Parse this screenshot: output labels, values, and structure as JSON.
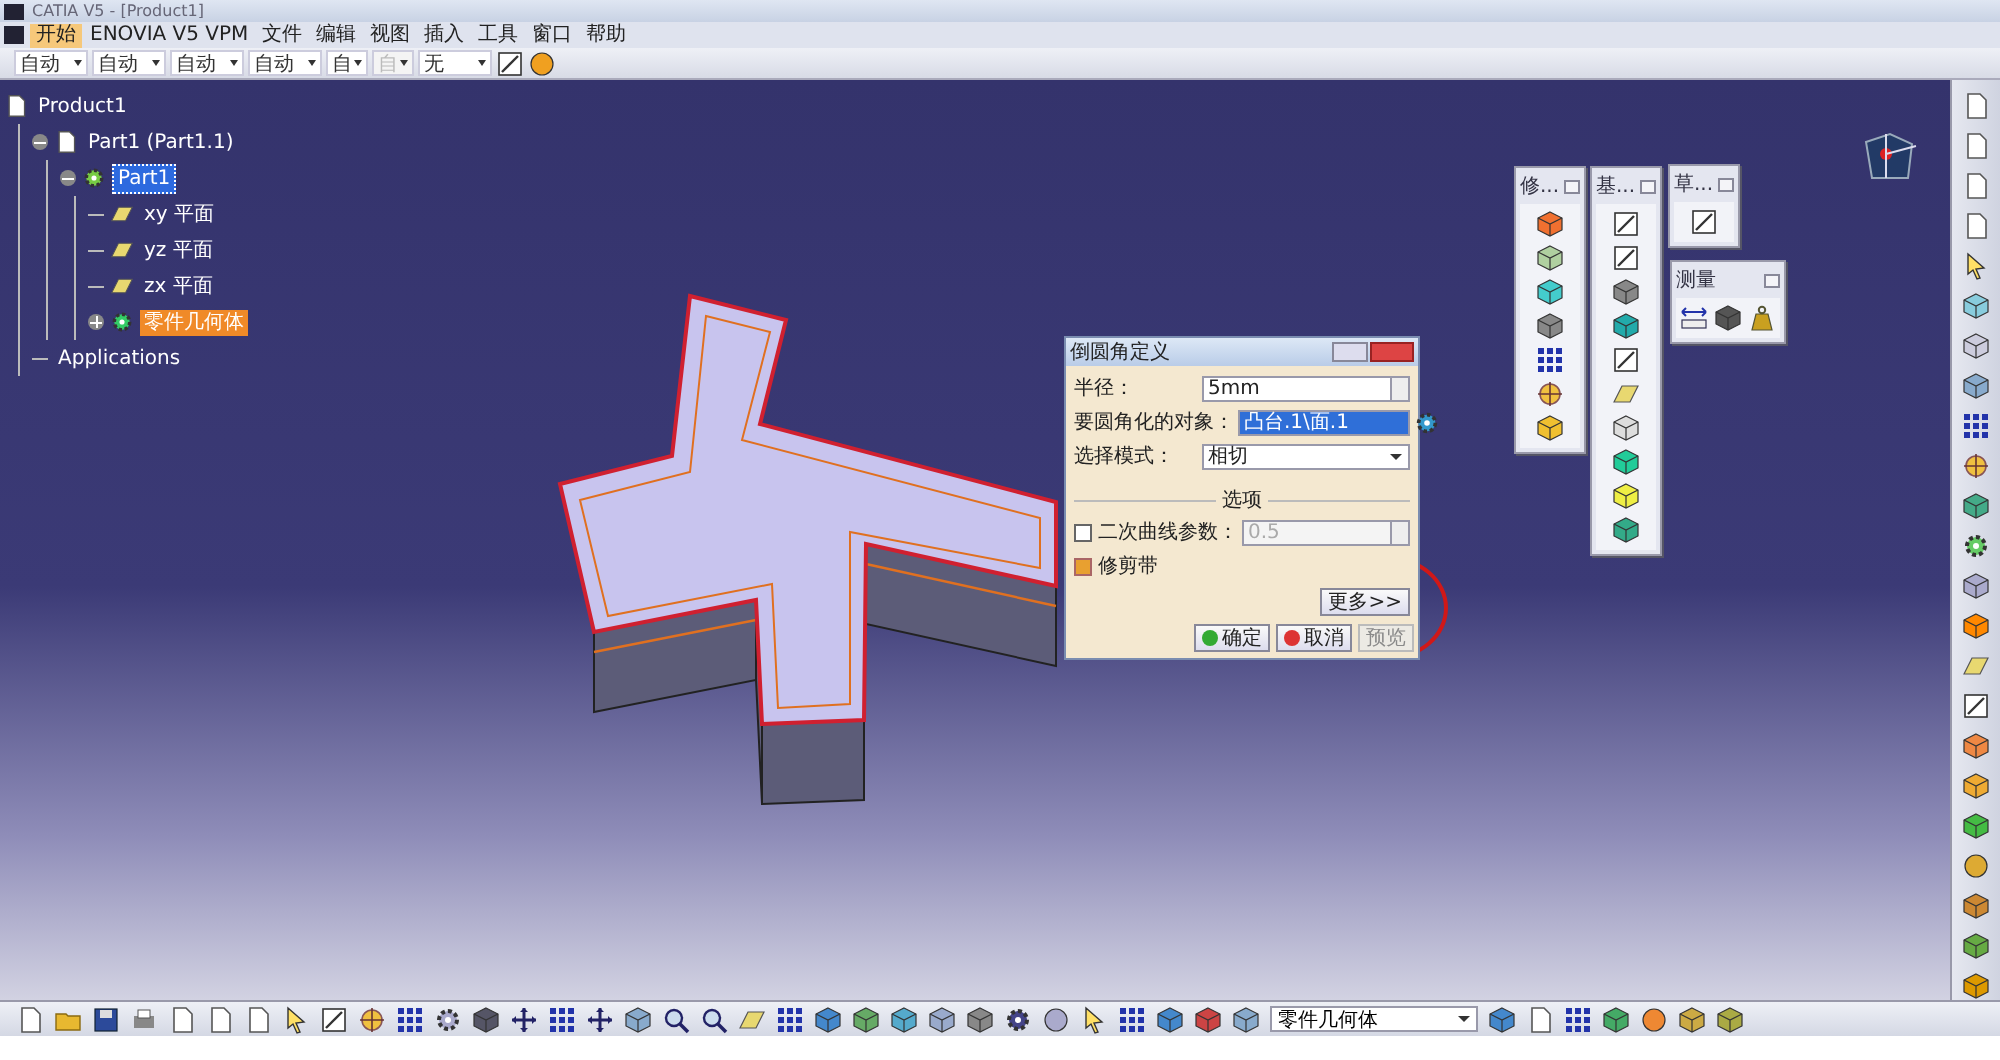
{
  "window": {
    "title": "CATIA V5 - [Product1]"
  },
  "menu": [
    {
      "label": "开始",
      "selected": true
    },
    {
      "label": "ENOVIA V5 VPM",
      "selected": false
    },
    {
      "label": "文件",
      "selected": false
    },
    {
      "label": "编辑",
      "selected": false
    },
    {
      "label": "视图",
      "selected": false
    },
    {
      "label": "插入",
      "selected": false
    },
    {
      "label": "工具",
      "selected": false
    },
    {
      "label": "窗口",
      "selected": false
    },
    {
      "label": "帮助",
      "selected": false
    }
  ],
  "toolbar": {
    "combos": [
      {
        "value": "自动",
        "disabled": false
      },
      {
        "value": "自动",
        "disabled": false
      },
      {
        "value": "自动",
        "disabled": false
      },
      {
        "value": "自动",
        "disabled": false
      },
      {
        "value": "自",
        "disabled": false
      },
      {
        "value": "自",
        "disabled": true
      },
      {
        "value": "无",
        "disabled": false
      }
    ]
  },
  "tree": [
    {
      "label": "Product1",
      "kind": "product",
      "selected": false,
      "highlighted": false,
      "children": [
        {
          "label": "Part1 (Part1.1)",
          "kind": "part",
          "selected": false,
          "highlighted": false,
          "expanded": true,
          "children": [
            {
              "label": "Part1",
              "kind": "partdoc",
              "selected": true,
              "highlighted": false,
              "expanded": true,
              "children": [
                {
                  "label": "xy 平面",
                  "kind": "plane",
                  "selected": false,
                  "highlighted": false
                },
                {
                  "label": "yz 平面",
                  "kind": "plane",
                  "selected": false,
                  "highlighted": false
                },
                {
                  "label": "zx 平面",
                  "kind": "plane",
                  "selected": false,
                  "highlighted": false
                },
                {
                  "label": "零件几何体",
                  "kind": "body",
                  "selected": false,
                  "highlighted": true,
                  "expanded": false
                }
              ]
            }
          ]
        },
        {
          "label": "Applications",
          "kind": "applications",
          "selected": false,
          "highlighted": false
        }
      ]
    }
  ],
  "floating_toolbars": [
    {
      "title": "修...",
      "kind": "vertical"
    },
    {
      "title": "基...",
      "kind": "vertical"
    },
    {
      "title": "草...",
      "kind": "vertical"
    },
    {
      "title": "测量",
      "kind": "horizontal"
    }
  ],
  "dialog": {
    "title": "倒圆角定义",
    "fields": [
      {
        "kind": "spin",
        "label": "半径：",
        "value": "5mm"
      },
      {
        "kind": "selection",
        "label": "要圆角化的对象：",
        "value": "凸台.1\\面.1"
      },
      {
        "kind": "dropdown",
        "label": "选择模式：",
        "value": "相切"
      }
    ],
    "section": "选项",
    "conic": {
      "label": "二次曲线参数：",
      "value": "0.5",
      "checked": false,
      "disabled": true
    },
    "trim": {
      "label": "修剪带",
      "checked": true
    },
    "more_button": "更多>>",
    "buttons": [
      {
        "label": "确定",
        "kind": "ok",
        "disabled": false
      },
      {
        "label": "取消",
        "kind": "cancel",
        "disabled": false
      },
      {
        "label": "预览",
        "kind": "preview",
        "disabled": true
      }
    ]
  },
  "bottom_toolbar": {
    "combo": "零件几何体"
  }
}
